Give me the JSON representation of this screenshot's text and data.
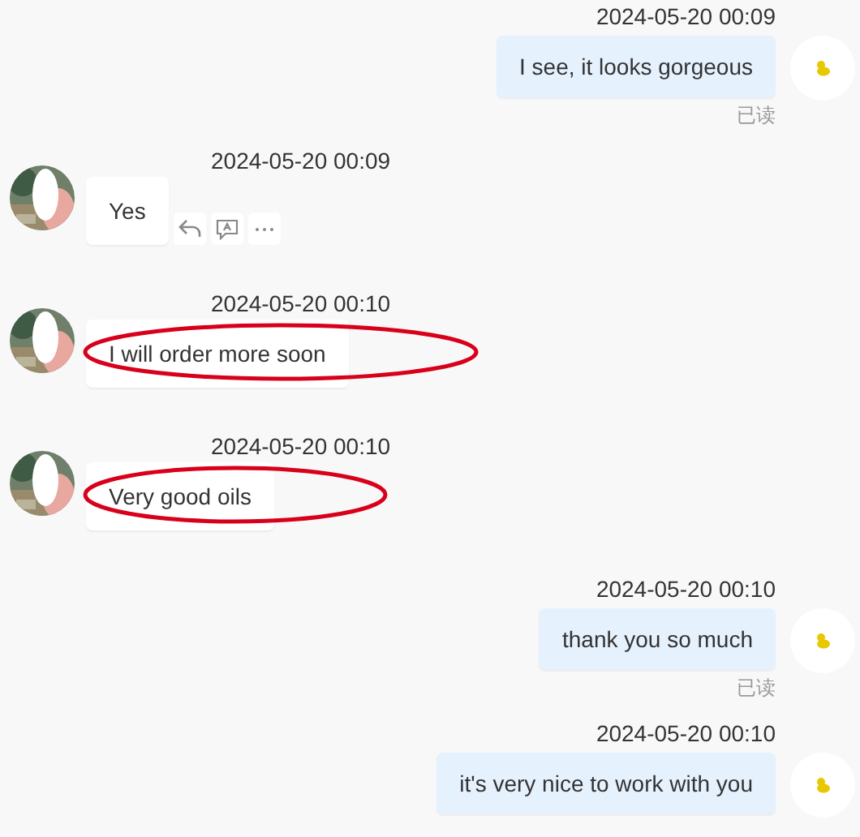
{
  "messages": [
    {
      "kind": "sent",
      "time": "2024-05-20 00:09",
      "text": "I see, it looks gorgeous",
      "read_label": "已读"
    },
    {
      "kind": "received",
      "time": "2024-05-20 00:09",
      "text": "Yes",
      "hovered": true,
      "circled": false
    },
    {
      "kind": "received",
      "time": "2024-05-20 00:10",
      "text": "I will order more soon",
      "hovered": false,
      "circled": true
    },
    {
      "kind": "received",
      "time": "2024-05-20 00:10",
      "text": "Very good oils",
      "hovered": false,
      "circled": true
    },
    {
      "kind": "sent",
      "time": "2024-05-20 00:10",
      "text": "thank you so much",
      "read_label": "已读"
    },
    {
      "kind": "sent",
      "time": "2024-05-20 00:10",
      "text": "it's very nice to work with you"
    }
  ]
}
